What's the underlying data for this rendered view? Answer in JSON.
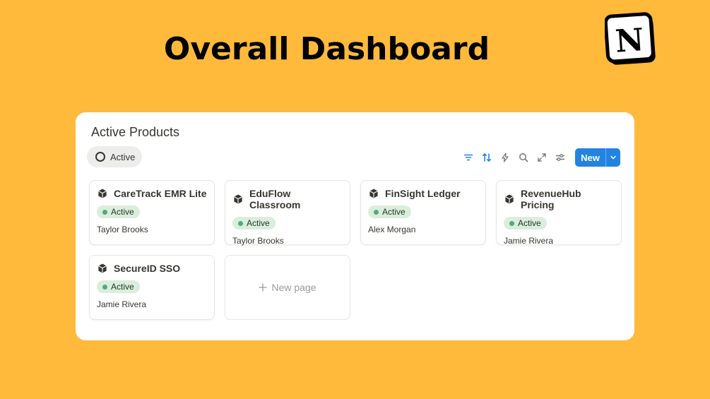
{
  "headline": "Overall Dashboard",
  "logo_letter": "N",
  "panel": {
    "title": "Active Products",
    "view_tab": "Active",
    "toolbar": {
      "icons": [
        "filter-icon",
        "sort-icon",
        "automation-icon",
        "search-icon",
        "expand-icon",
        "settings-icon"
      ],
      "new_label": "New"
    }
  },
  "cards": [
    {
      "title": "CareTrack EMR Lite",
      "status": "Active",
      "owner": "Taylor Brooks"
    },
    {
      "title": "EduFlow Classroom",
      "status": "Active",
      "owner": "Taylor Brooks"
    },
    {
      "title": "FinSight Ledger",
      "status": "Active",
      "owner": "Alex Morgan"
    },
    {
      "title": "RevenueHub Pricing",
      "status": "Active",
      "owner": "Jamie Rivera"
    },
    {
      "title": "SecureID SSO",
      "status": "Active",
      "owner": "Jamie Rivera"
    }
  ],
  "new_page_label": "New page",
  "colors": {
    "background": "#FFBA3B",
    "accent": "#2383e2",
    "status_bg": "#dbeddb",
    "status_dot": "#4dab7c"
  }
}
